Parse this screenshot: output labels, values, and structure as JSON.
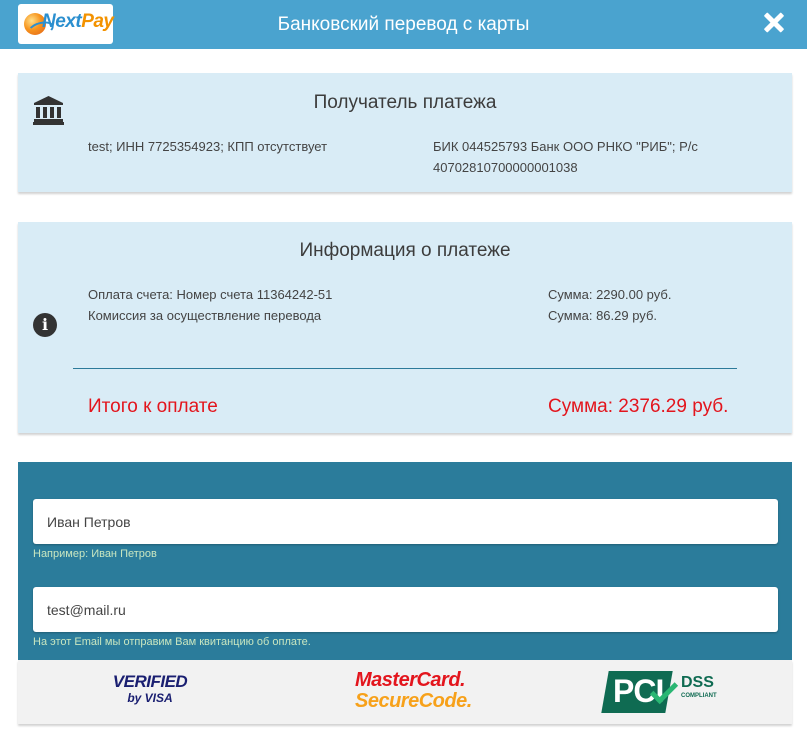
{
  "header": {
    "logo": {
      "part1": "Next",
      "part2": "Pay"
    },
    "title": "Банковский перевод с карты",
    "close_icon": "close-icon"
  },
  "recipient": {
    "heading": "Получатель платежа",
    "icon": "bank-icon",
    "left_text": "test; ИНН 7725354923; КПП отсутствует",
    "right_line1": "БИК 044525793 Банк ООО РНКО \"РИБ\"; Р/с",
    "right_line2": "40702810700000001038"
  },
  "payment_info": {
    "heading": "Информация о платеже",
    "icon": "info-icon",
    "rows": [
      {
        "label": "Оплата счета: Номер счета 11364242-51",
        "amount": "Сумма: 2290.00 руб."
      },
      {
        "label": "Комиссия за осуществление перевода",
        "amount": "Сумма: 86.29 руб."
      }
    ],
    "total_label": "Итого к оплате",
    "total_amount": "Сумма: 2376.29 руб.",
    "accent_color": "#e3151d"
  },
  "form": {
    "name_value": "Иван Петров",
    "name_hint": "Например: Иван Петров",
    "email_value": "test@mail.ru",
    "email_hint": "На этот Email мы отправим Вам квитанцию об оплате."
  },
  "badges": {
    "visa_line1": "VERIFIED",
    "visa_line2": "by VISA",
    "mc_line1": "MasterCard.",
    "mc_line2": "SecureCode.",
    "pci_main": "PCI",
    "pci_dss": "DSS",
    "pci_compliant": "COMPLIANT"
  },
  "colors": {
    "header": "#4aa3cf",
    "card": "#d9ecf6",
    "form": "#2b7c9b"
  }
}
